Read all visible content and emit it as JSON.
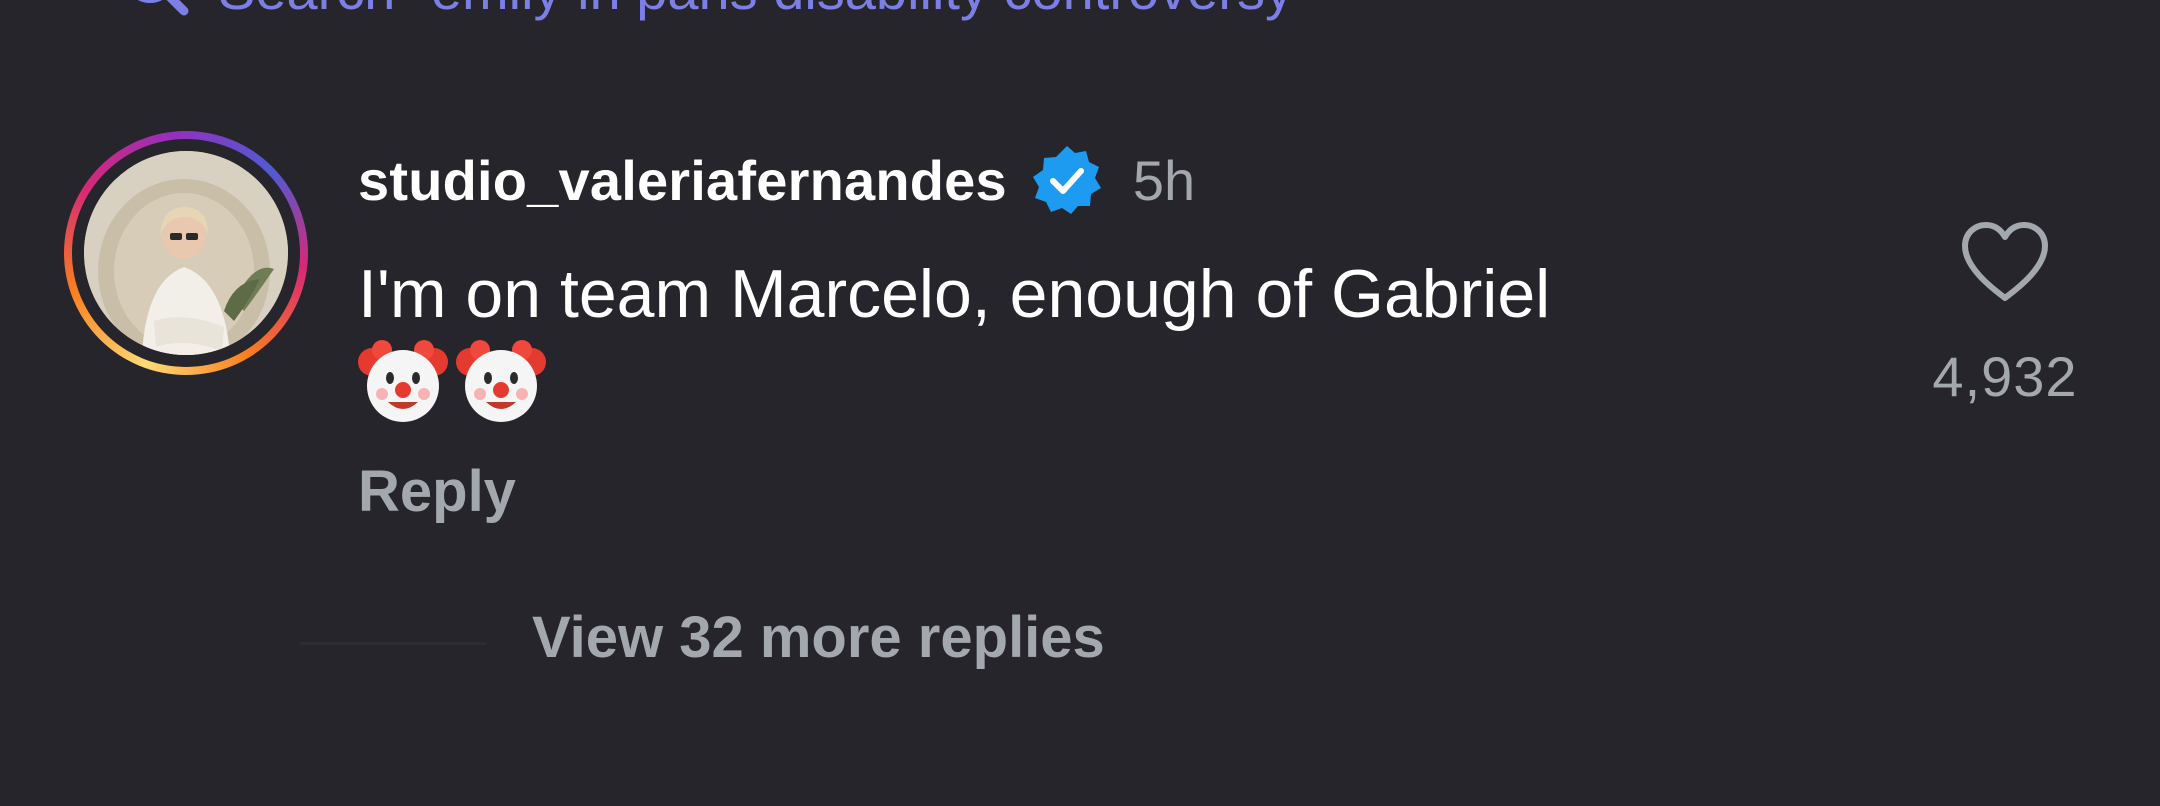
{
  "search": {
    "suggestion_text": "Search \"emily in paris disability controversy\"",
    "icon": "search-icon",
    "accent_color": "#7c80e6"
  },
  "comment": {
    "username": "studio_valeriafernandes",
    "verified": true,
    "verified_icon": "verified-badge-icon",
    "verified_color": "#1d9bf0",
    "timestamp": "5h",
    "text": "I'm on team Marcelo, enough of Gabriel",
    "emojis": [
      "clown-face-icon",
      "clown-face-icon"
    ],
    "reply_label": "Reply",
    "like_icon": "heart-icon",
    "like_count": "4,932",
    "view_replies_label": "View 32 more replies"
  },
  "colors": {
    "background": "#25252b",
    "primary_text": "#ffffff",
    "secondary_text": "#a3a7ae"
  }
}
